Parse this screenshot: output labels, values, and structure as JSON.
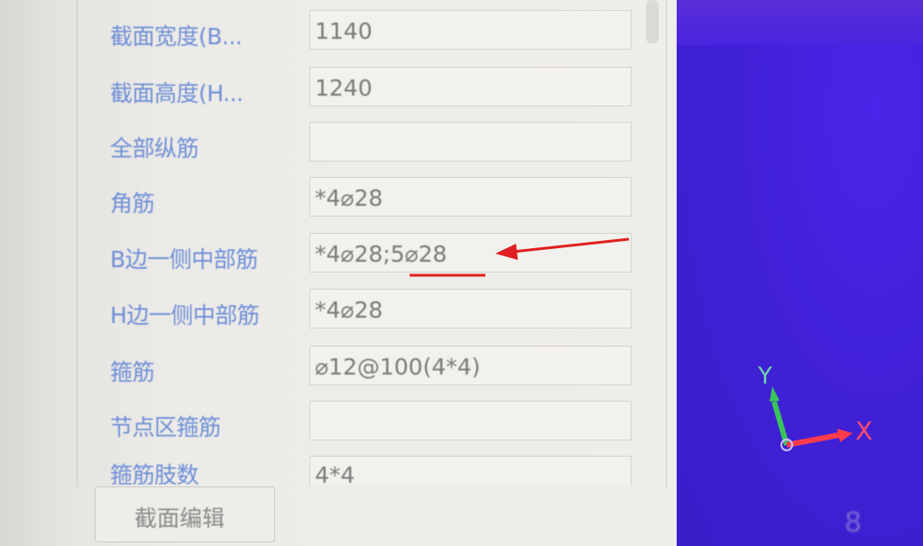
{
  "properties": [
    {
      "label": "截面宽度(B...",
      "value": "1140"
    },
    {
      "label": "截面高度(H...",
      "value": "1240"
    },
    {
      "label": "全部纵筋",
      "value": ""
    },
    {
      "label": "角筋",
      "value": "*4⌀28"
    },
    {
      "label": "B边一侧中部筋",
      "value": "*4⌀28;5⌀28"
    },
    {
      "label": "H边一侧中部筋",
      "value": "*4⌀28"
    },
    {
      "label": "箍筋",
      "value": "⌀12@100(4*4)"
    },
    {
      "label": "节点区箍筋",
      "value": ""
    },
    {
      "label": "箍筋肢数",
      "value": "4*4"
    }
  ],
  "edit_button": "截面编辑",
  "viewport": {
    "axis_x": "X",
    "axis_y": "Y",
    "page_number": "8",
    "background_color": "#4020d6",
    "x_axis_color": "#ff3b4e",
    "y_axis_color": "#39c45a"
  },
  "annotation": {
    "color": "#e02020",
    "target": "5⌀28"
  }
}
